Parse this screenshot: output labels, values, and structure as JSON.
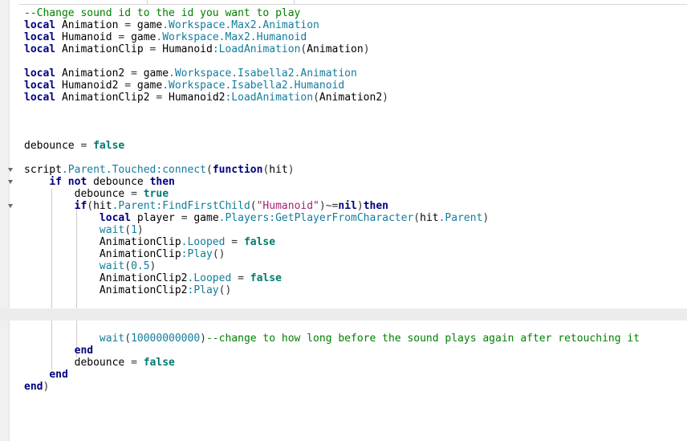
{
  "colors": {
    "comment": "#008000",
    "keyword": "#000080",
    "identifier": "#000000",
    "member": "#127c9d",
    "operator": "#333333",
    "string": "#9d2474",
    "number": "#127c9d",
    "bool": "#007b6f",
    "current_line": "#ececec"
  },
  "code": {
    "lines": [
      {
        "tokens": [
          {
            "t": "--Change sound id to the id you want to play",
            "k": "comment"
          }
        ]
      },
      {
        "tokens": [
          {
            "t": "local",
            "k": "keyword"
          },
          {
            "t": " Animation ",
            "k": "identifier"
          },
          {
            "t": "=",
            "k": "operator"
          },
          {
            "t": " game",
            "k": "identifier"
          },
          {
            "t": ".Workspace.Max2.Animation",
            "k": "member"
          }
        ]
      },
      {
        "tokens": [
          {
            "t": "local",
            "k": "keyword"
          },
          {
            "t": " Humanoid ",
            "k": "identifier"
          },
          {
            "t": "=",
            "k": "operator"
          },
          {
            "t": " game",
            "k": "identifier"
          },
          {
            "t": ".Workspace.Max2.Humanoid",
            "k": "member"
          }
        ]
      },
      {
        "tokens": [
          {
            "t": "local",
            "k": "keyword"
          },
          {
            "t": " AnimationClip ",
            "k": "identifier"
          },
          {
            "t": "=",
            "k": "operator"
          },
          {
            "t": " Humanoid",
            "k": "identifier"
          },
          {
            "t": ":LoadAnimation",
            "k": "member"
          },
          {
            "t": "(",
            "k": "operator"
          },
          {
            "t": "Animation",
            "k": "identifier"
          },
          {
            "t": ")",
            "k": "operator"
          }
        ]
      },
      {
        "tokens": []
      },
      {
        "tokens": [
          {
            "t": "local",
            "k": "keyword"
          },
          {
            "t": " Animation2 ",
            "k": "identifier"
          },
          {
            "t": "=",
            "k": "operator"
          },
          {
            "t": " game",
            "k": "identifier"
          },
          {
            "t": ".Workspace.Isabella2.Animation",
            "k": "member"
          }
        ]
      },
      {
        "tokens": [
          {
            "t": "local",
            "k": "keyword"
          },
          {
            "t": " Humanoid2 ",
            "k": "identifier"
          },
          {
            "t": "=",
            "k": "operator"
          },
          {
            "t": " game",
            "k": "identifier"
          },
          {
            "t": ".Workspace.Isabella2.Humanoid",
            "k": "member"
          }
        ]
      },
      {
        "tokens": [
          {
            "t": "local",
            "k": "keyword"
          },
          {
            "t": " AnimationClip2 ",
            "k": "identifier"
          },
          {
            "t": "=",
            "k": "operator"
          },
          {
            "t": " Humanoid2",
            "k": "identifier"
          },
          {
            "t": ":LoadAnimation",
            "k": "member"
          },
          {
            "t": "(",
            "k": "operator"
          },
          {
            "t": "Animation2",
            "k": "identifier"
          },
          {
            "t": ")",
            "k": "operator"
          }
        ]
      },
      {
        "tokens": []
      },
      {
        "tokens": []
      },
      {
        "tokens": []
      },
      {
        "tokens": [
          {
            "t": "debounce ",
            "k": "identifier"
          },
          {
            "t": "=",
            "k": "operator"
          },
          {
            "t": " false",
            "k": "bool"
          }
        ]
      },
      {
        "tokens": []
      },
      {
        "fold": true,
        "tokens": [
          {
            "t": "script",
            "k": "identifier"
          },
          {
            "t": ".Parent.Touched:connect",
            "k": "member"
          },
          {
            "t": "(",
            "k": "operator"
          },
          {
            "t": "function",
            "k": "keyword"
          },
          {
            "t": "(",
            "k": "operator"
          },
          {
            "t": "hit",
            "k": "identifier"
          },
          {
            "t": ")",
            "k": "operator"
          }
        ]
      },
      {
        "fold": true,
        "tokens": [
          {
            "t": "    ",
            "k": "identifier"
          },
          {
            "t": "if not",
            "k": "keyword"
          },
          {
            "t": " debounce ",
            "k": "identifier"
          },
          {
            "t": "then",
            "k": "keyword"
          }
        ]
      },
      {
        "tokens": [
          {
            "t": "        debounce ",
            "k": "identifier"
          },
          {
            "t": "=",
            "k": "operator"
          },
          {
            "t": " true",
            "k": "bool"
          }
        ]
      },
      {
        "fold": true,
        "tokens": [
          {
            "t": "        ",
            "k": "identifier"
          },
          {
            "t": "if",
            "k": "keyword"
          },
          {
            "t": "(",
            "k": "operator"
          },
          {
            "t": "hit",
            "k": "identifier"
          },
          {
            "t": ".Parent:FindFirstChild",
            "k": "member"
          },
          {
            "t": "(",
            "k": "operator"
          },
          {
            "t": "\"Humanoid\"",
            "k": "string"
          },
          {
            "t": ")~=",
            "k": "operator"
          },
          {
            "t": "nil",
            "k": "keyword"
          },
          {
            "t": ")",
            "k": "operator"
          },
          {
            "t": "then",
            "k": "keyword"
          }
        ]
      },
      {
        "tokens": [
          {
            "t": "            ",
            "k": "identifier"
          },
          {
            "t": "local",
            "k": "keyword"
          },
          {
            "t": " player ",
            "k": "identifier"
          },
          {
            "t": "=",
            "k": "operator"
          },
          {
            "t": " game",
            "k": "identifier"
          },
          {
            "t": ".Players:GetPlayerFromCharacter",
            "k": "member"
          },
          {
            "t": "(",
            "k": "operator"
          },
          {
            "t": "hit",
            "k": "identifier"
          },
          {
            "t": ".Parent",
            "k": "member"
          },
          {
            "t": ")",
            "k": "operator"
          }
        ]
      },
      {
        "tokens": [
          {
            "t": "            ",
            "k": "identifier"
          },
          {
            "t": "wait",
            "k": "member"
          },
          {
            "t": "(",
            "k": "operator"
          },
          {
            "t": "1",
            "k": "number"
          },
          {
            "t": ")",
            "k": "operator"
          }
        ]
      },
      {
        "tokens": [
          {
            "t": "            AnimationClip",
            "k": "identifier"
          },
          {
            "t": ".Looped",
            "k": "member"
          },
          {
            "t": " = ",
            "k": "operator"
          },
          {
            "t": "false",
            "k": "bool"
          }
        ]
      },
      {
        "tokens": [
          {
            "t": "            AnimationClip",
            "k": "identifier"
          },
          {
            "t": ":Play",
            "k": "member"
          },
          {
            "t": "()",
            "k": "operator"
          }
        ]
      },
      {
        "tokens": [
          {
            "t": "            ",
            "k": "identifier"
          },
          {
            "t": "wait",
            "k": "member"
          },
          {
            "t": "(",
            "k": "operator"
          },
          {
            "t": "0.5",
            "k": "number"
          },
          {
            "t": ")",
            "k": "operator"
          }
        ]
      },
      {
        "tokens": [
          {
            "t": "            AnimationClip2",
            "k": "identifier"
          },
          {
            "t": ".Looped",
            "k": "member"
          },
          {
            "t": " = ",
            "k": "operator"
          },
          {
            "t": "false",
            "k": "bool"
          }
        ]
      },
      {
        "tokens": [
          {
            "t": "            AnimationClip2",
            "k": "identifier"
          },
          {
            "t": ":Play",
            "k": "member"
          },
          {
            "t": "()",
            "k": "operator"
          }
        ]
      },
      {
        "tokens": []
      },
      {
        "current": true,
        "tokens": []
      },
      {
        "tokens": []
      },
      {
        "tokens": [
          {
            "t": "            ",
            "k": "identifier"
          },
          {
            "t": "wait",
            "k": "member"
          },
          {
            "t": "(",
            "k": "operator"
          },
          {
            "t": "10000000000",
            "k": "number"
          },
          {
            "t": ")",
            "k": "operator"
          },
          {
            "t": "--change to how long before the sound plays again after retouching it",
            "k": "comment"
          }
        ]
      },
      {
        "tokens": [
          {
            "t": "        ",
            "k": "identifier"
          },
          {
            "t": "end",
            "k": "keyword"
          }
        ]
      },
      {
        "tokens": [
          {
            "t": "        debounce ",
            "k": "identifier"
          },
          {
            "t": "=",
            "k": "operator"
          },
          {
            "t": " false",
            "k": "bool"
          }
        ]
      },
      {
        "tokens": [
          {
            "t": "    ",
            "k": "identifier"
          },
          {
            "t": "end",
            "k": "keyword"
          }
        ]
      },
      {
        "tokens": [
          {
            "t": "end",
            "k": "keyword"
          },
          {
            "t": ")",
            "k": "operator"
          }
        ]
      }
    ]
  }
}
